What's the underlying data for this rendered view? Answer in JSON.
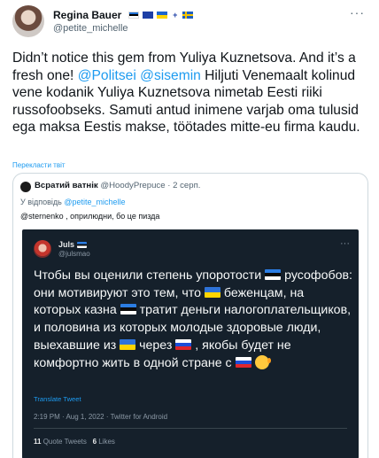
{
  "author": {
    "name": "Regina Bauer",
    "flags": [
      "flag-estonia-icon",
      "flag-eu-icon",
      "flag-ukraine-icon",
      "plus-icon",
      "flag-sweden-icon"
    ],
    "handle": "@petite_michelle",
    "more": "···"
  },
  "tweet": {
    "text_1": "Didn’t notice this gem from Yuliya Kuznetsova. And it’s a fresh one! ",
    "mention_1": "@Politsei",
    "space": " ",
    "mention_2": "@sisemin",
    "text_2": " Hiljuti Venemaalt kolinud vene kodanik Yuliya Kuznetsova nimetab Eesti riiki russofoobseks. Samuti antud inimene varjab oma tulusid ega maksa Eestis makse, töötades mitte-eu firma kaudu.",
    "translate": "Перекласти твіт"
  },
  "quote": {
    "name": "Всратий ватнік",
    "handle": "@HoodyPrepuce",
    "sep": " · ",
    "date": "2 серп.",
    "reply_prefix": "У відповідь ",
    "reply_handle": "@petite_michelle",
    "body": "@sternenko , оприлюдни, бо це пизда"
  },
  "screenshot": {
    "name": "Juls",
    "handle": "@julsmao",
    "more": "···",
    "text_1": "Чтобы вы оценили степень упоротости ",
    "text_2": " русофобов: они мотивируют это тем, что ",
    "text_3": " беженцам, на которых казна ",
    "text_4": " тратит деньги налогоплательщиков, и половина из которых молодые здоровые люди, выехавшие из ",
    "text_5": " через ",
    "text_6": " , якобы будет не комфортно жить в одной стране с ",
    "translate": "Translate Tweet",
    "time": "2:19 PM · Aug 1, 2022 · Twitter for Android",
    "quote_tweets_count": "11",
    "quote_tweets_label": " Quote Tweets",
    "likes_count": "6",
    "likes_label": " Likes"
  }
}
